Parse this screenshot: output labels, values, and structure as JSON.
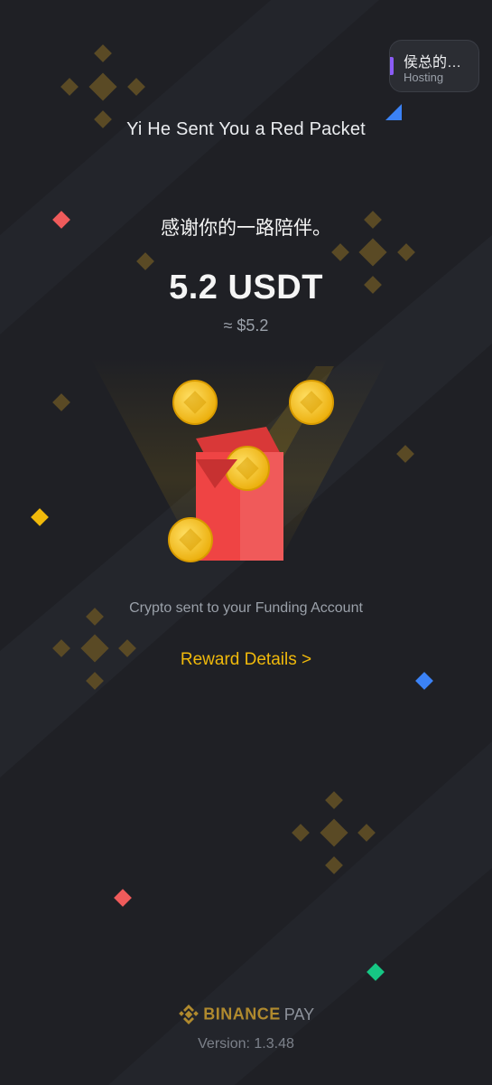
{
  "host": {
    "name": "侯总的…",
    "role": "Hosting"
  },
  "packet": {
    "title": "Yi He Sent You a Red Packet",
    "message": "感谢你的一路陪伴。",
    "amount": "5.2 USDT",
    "fiat": "≈ $5.2",
    "funding_note": "Crypto sent to your Funding Account",
    "reward_link": "Reward Details >"
  },
  "footer": {
    "brand": "BINANCE",
    "pay": "PAY",
    "version": "Version: 1.3.48"
  },
  "colors": {
    "accent": "#f0b90b",
    "envelope": "#ef4444",
    "background": "#1f2025"
  }
}
